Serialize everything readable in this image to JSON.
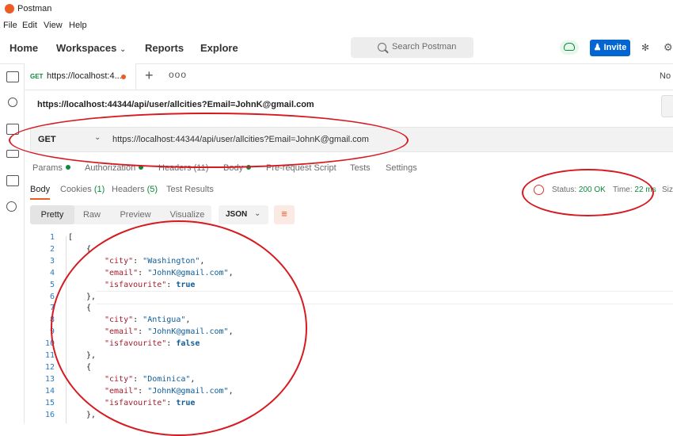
{
  "window": {
    "title": "Postman"
  },
  "menu": [
    "File",
    "Edit",
    "View",
    "Help"
  ],
  "nav": {
    "home": "Home",
    "workspaces": "Workspaces",
    "reports": "Reports",
    "explore": "Explore"
  },
  "search": {
    "placeholder": "Search Postman"
  },
  "invite": "Invite",
  "tab": {
    "method": "GET",
    "title": "https://localhost:4...",
    "plus": "+",
    "more": "ooo"
  },
  "environment": "No",
  "request": {
    "name": "https://localhost:44344/api/user/allcities?Email=JohnK@gmail.com",
    "method": "GET",
    "url": "https://localhost:44344/api/user/allcities?Email=JohnK@gmail.com"
  },
  "request_tabs": {
    "params": "Params",
    "authorization": "Authorization",
    "headers": "Headers",
    "headers_count": "(11)",
    "body": "Body",
    "prerequest": "Pre-request Script",
    "tests": "Tests",
    "settings": "Settings"
  },
  "response_tabs": {
    "body": "Body",
    "cookies": "Cookies",
    "cookies_count": "(1)",
    "headers": "Headers",
    "headers_count": "(5)",
    "test_results": "Test Results"
  },
  "response_status": {
    "status_label": "Status:",
    "status_value": "200 OK",
    "time_label": "Time:",
    "time_value": "22 ms",
    "size_label": "Size"
  },
  "format": {
    "pretty": "Pretty",
    "raw": "Raw",
    "preview": "Preview",
    "visualize": "Visualize",
    "json": "JSON"
  },
  "code_lines": [
    {
      "n": "1",
      "indent": 0,
      "text": "["
    },
    {
      "n": "2",
      "indent": 1,
      "text": "{"
    },
    {
      "n": "3",
      "indent": 2,
      "key": "\"city\"",
      "value": "\"Washington\"",
      "type": "str",
      "comma": true
    },
    {
      "n": "4",
      "indent": 2,
      "key": "\"email\"",
      "value": "\"JohnK@gmail.com\"",
      "type": "str",
      "comma": true
    },
    {
      "n": "5",
      "indent": 2,
      "key": "\"isfavourite\"",
      "value": "true",
      "type": "bool",
      "comma": false
    },
    {
      "n": "6",
      "indent": 1,
      "text": "},"
    },
    {
      "n": "7",
      "indent": 1,
      "text": "{"
    },
    {
      "n": "8",
      "indent": 2,
      "key": "\"city\"",
      "value": "\"Antigua\"",
      "type": "str",
      "comma": true
    },
    {
      "n": "9",
      "indent": 2,
      "key": "\"email\"",
      "value": "\"JohnK@gmail.com\"",
      "type": "str",
      "comma": true
    },
    {
      "n": "10",
      "indent": 2,
      "key": "\"isfavourite\"",
      "value": "false",
      "type": "bool",
      "comma": false
    },
    {
      "n": "11",
      "indent": 1,
      "text": "},"
    },
    {
      "n": "12",
      "indent": 1,
      "text": "{"
    },
    {
      "n": "13",
      "indent": 2,
      "key": "\"city\"",
      "value": "\"Dominica\"",
      "type": "str",
      "comma": true
    },
    {
      "n": "14",
      "indent": 2,
      "key": "\"email\"",
      "value": "\"JohnK@gmail.com\"",
      "type": "str",
      "comma": true
    },
    {
      "n": "15",
      "indent": 2,
      "key": "\"isfavourite\"",
      "value": "true",
      "type": "bool",
      "comma": false
    },
    {
      "n": "16",
      "indent": 1,
      "text": "},"
    }
  ],
  "colors": {
    "accent": "#ef5b25",
    "brand_blue": "#0265d2",
    "success": "#0c8a3e",
    "annotation": "#d71920"
  },
  "icons": [
    "postman-logo-icon",
    "search-icon",
    "cloud-sync-icon",
    "invite-person-icon",
    "satellite-icon",
    "settings-icon",
    "collections-icon",
    "apis-icon",
    "environments-icon",
    "mock-servers-icon",
    "monitors-icon",
    "history-icon",
    "save-icon",
    "globe-icon",
    "wrap-lines-icon",
    "chevron-down-icon"
  ]
}
